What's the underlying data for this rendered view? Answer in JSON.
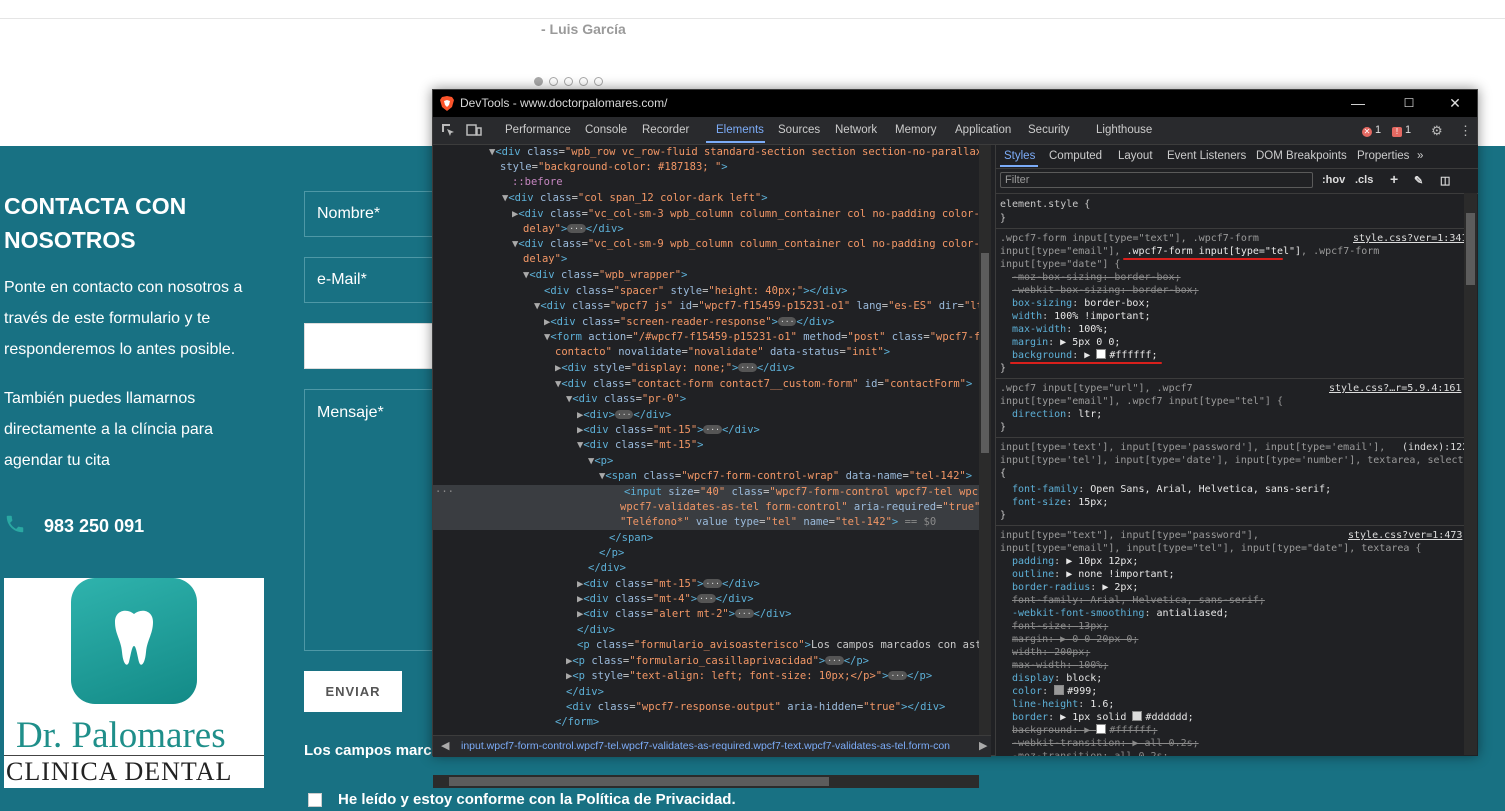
{
  "site": {
    "quote_author": "- Luis García",
    "contact_title": "CONTACTA CON NOSOTROS",
    "contact_intro": "Ponte en contacto con nosotros a través de este formulario y te responderemos lo antes posible.",
    "contact_call": "También puedes llamarnos directamente a la clíncia para agendar tu cita",
    "phone": "983 250 091",
    "logo_name": "Dr. Palomares",
    "logo_sub": "CLINICA DENTAL",
    "form": {
      "nombre_placeholder": "Nombre*",
      "email_placeholder": "e-Mail*",
      "tel_value": "",
      "mensaje_placeholder": "Mensaje*",
      "submit_label": "ENVIAR",
      "required_note": "Los campos marca",
      "privacy_label": "He leído y estoy conforme con la Política de Privacidad."
    }
  },
  "devtools": {
    "window_title": "DevTools - www.doctorpalomares.com/",
    "tabs": [
      "Performance",
      "Console",
      "Recorder",
      "Elements",
      "Sources",
      "Network",
      "Memory",
      "Application",
      "Security",
      "Lighthouse"
    ],
    "active_tab": "Elements",
    "errors_count": "1",
    "issues_count": "1",
    "breadcrumb": "input.wpcf7-form-control.wpcf7-tel.wpcf7-validates-as-required.wpcf7-text.wpcf7-validates-as-tel.form-con",
    "styles_tabs": [
      "Styles",
      "Computed",
      "Layout",
      "Event Listeners",
      "DOM Breakpoints",
      "Properties"
    ],
    "filter_placeholder": "Filter",
    "hov_label": ":hov",
    "cls_label": ".cls",
    "element_style": "element.style {",
    "rule1": {
      "selector_a": ".wpcf7-form input[type=\"text\"], .wpcf7-form",
      "selector_b1": "input[type=\"email\"], ",
      "selector_b2": ".wpcf7-form input[type=\"tel\"]",
      "selector_b3": ", .wpcf7-form",
      "selector_c": "input[type=\"date\"] {",
      "source": "style.css?ver=1:3411",
      "background_value": "#ffffff"
    },
    "rule2": {
      "selector_a": ".wpcf7 input[type=\"url\"], .wpcf7",
      "selector_b": "input[type=\"email\"], .wpcf7 input[type=\"tel\"] {",
      "source": "style.css?…r=5.9.4:161"
    },
    "rule3": {
      "selector_a": "input[type='text'], input[type='password'], input[type='email'],",
      "selector_b": "input[type='tel'], input[type='date'], input[type='number'], textarea, select",
      "source": "(index):122"
    },
    "rule4": {
      "selector_a": "input[type=\"text\"], input[type=\"password\"],",
      "selector_b": "input[type=\"email\"], input[type=\"tel\"], input[type=\"date\"], textarea {",
      "source": "style.css?ver=1:473"
    },
    "colors": {
      "accent": "#7cacf8",
      "site_band": "#187183",
      "error": "#e46962",
      "annotation": "#d9201c"
    }
  }
}
